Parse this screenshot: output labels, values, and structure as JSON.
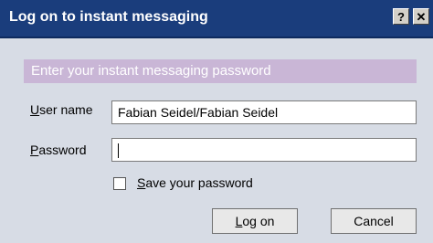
{
  "window": {
    "title": "Log on to instant messaging",
    "help_glyph": "?",
    "close_glyph": "✕"
  },
  "form": {
    "header": "Enter your instant messaging password",
    "username": {
      "label_first": "U",
      "label_rest": "ser name",
      "value": "Fabian Seidel/Fabian Seidel"
    },
    "password": {
      "label_first": "P",
      "label_rest": "assword",
      "value": ""
    },
    "save_password": {
      "label_first": "S",
      "label_rest": "ave your password",
      "checked": false
    }
  },
  "buttons": {
    "logon_first": "L",
    "logon_rest": "og on",
    "cancel": "Cancel"
  },
  "colors": {
    "titlebar": "#1a3d7c",
    "header_band": "#c9b6d6",
    "background": "#d7dce5"
  }
}
